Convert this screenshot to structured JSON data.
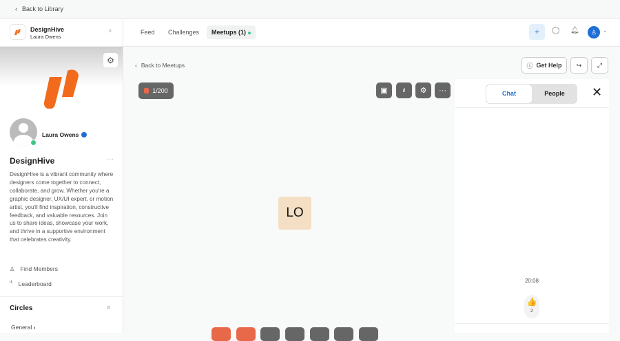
{
  "topbar": {
    "back": "Back to Library"
  },
  "community": {
    "name": "DesignHive",
    "owner": "Laura Owens",
    "profile_name": "Laura Owens",
    "title": "DesignHive",
    "description": "DesignHive is a vibrant community where designers come together to connect, collaborate, and grow. Whether you're a graphic designer, UX/UI expert, or motion artist, you'll find inspiration, constructive feedback, and valuable resources. Join us to share ideas, showcase your work, and thrive in a supportive environment that celebrates creativity.",
    "links": [
      "Find Members",
      "Leaderboard"
    ],
    "circles_title": "Circles",
    "circles": [
      "General"
    ]
  },
  "tabs": [
    "Feed",
    "Challenges",
    "Meetups (1)"
  ],
  "main": {
    "back": "Back to Meetups",
    "get_help": "Get Help",
    "attendees": "1/200",
    "avatar_initials": "LO"
  },
  "chat": {
    "tabs": [
      "Chat",
      "People"
    ],
    "time": "20:08",
    "reaction": "👍",
    "reaction_count": "2"
  },
  "colors": {
    "accent": "#f26b1d",
    "online": "#3cc88a",
    "link": "#1f6fd6"
  }
}
